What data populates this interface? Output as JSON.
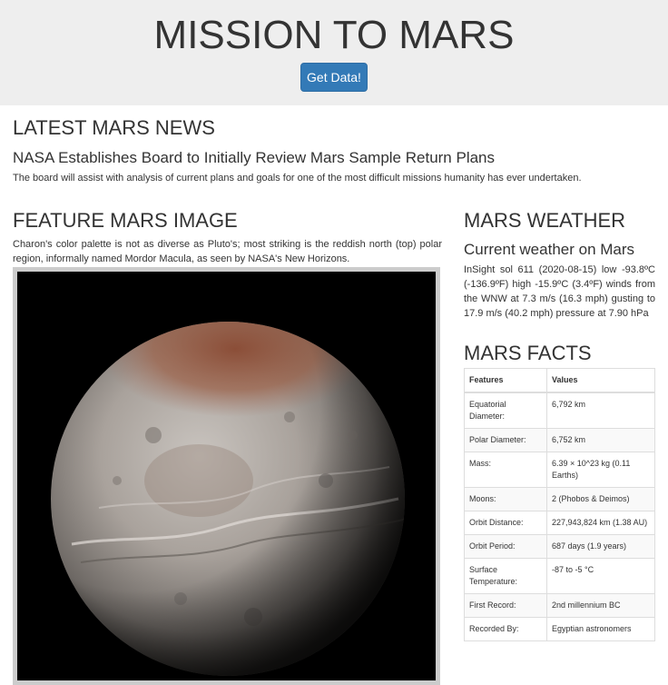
{
  "header": {
    "title": "MISSION TO MARS",
    "button_label": "Get Data!"
  },
  "news": {
    "heading": "LATEST MARS NEWS",
    "title": "NASA Establishes Board to Initially Review Mars Sample Return Plans",
    "teaser": "The board will assist with analysis of current plans and goals for one of the most difficult missions humanity has ever undertaken."
  },
  "feature": {
    "heading": "FEATURE MARS IMAGE",
    "description": "Charon's color palette is not as diverse as Pluto's; most striking is the reddish north (top) polar region, informally named Mordor Macula, as seen by NASA's New Horizons."
  },
  "weather": {
    "heading": "MARS WEATHER",
    "subheading": "Current weather on Mars",
    "report": "InSight sol 611 (2020-08-15) low -93.8ºC (-136.9ºF) high -15.9ºC (3.4ºF) winds from the WNW at 7.3 m/s (16.3 mph) gusting to 17.9 m/s (40.2 mph) pressure at 7.90 hPa"
  },
  "facts": {
    "heading": "MARS FACTS",
    "columns": [
      "Features",
      "Values"
    ],
    "rows": [
      [
        "Equatorial Diameter:",
        "6,792 km"
      ],
      [
        "Polar Diameter:",
        "6,752 km"
      ],
      [
        "Mass:",
        "6.39 × 10^23 kg (0.11 Earths)"
      ],
      [
        "Moons:",
        "2 (Phobos & Deimos)"
      ],
      [
        "Orbit Distance:",
        "227,943,824 km (1.38 AU)"
      ],
      [
        "Orbit Period:",
        "687 days (1.9 years)"
      ],
      [
        "Surface Temperature:",
        "-87 to -5 °C"
      ],
      [
        "First Record:",
        "2nd millennium BC"
      ],
      [
        "Recorded By:",
        "Egyptian astronomers"
      ]
    ]
  },
  "colors": {
    "jumbotron_bg": "#eeeeee",
    "button_bg": "#337ab7",
    "text": "#333333"
  }
}
